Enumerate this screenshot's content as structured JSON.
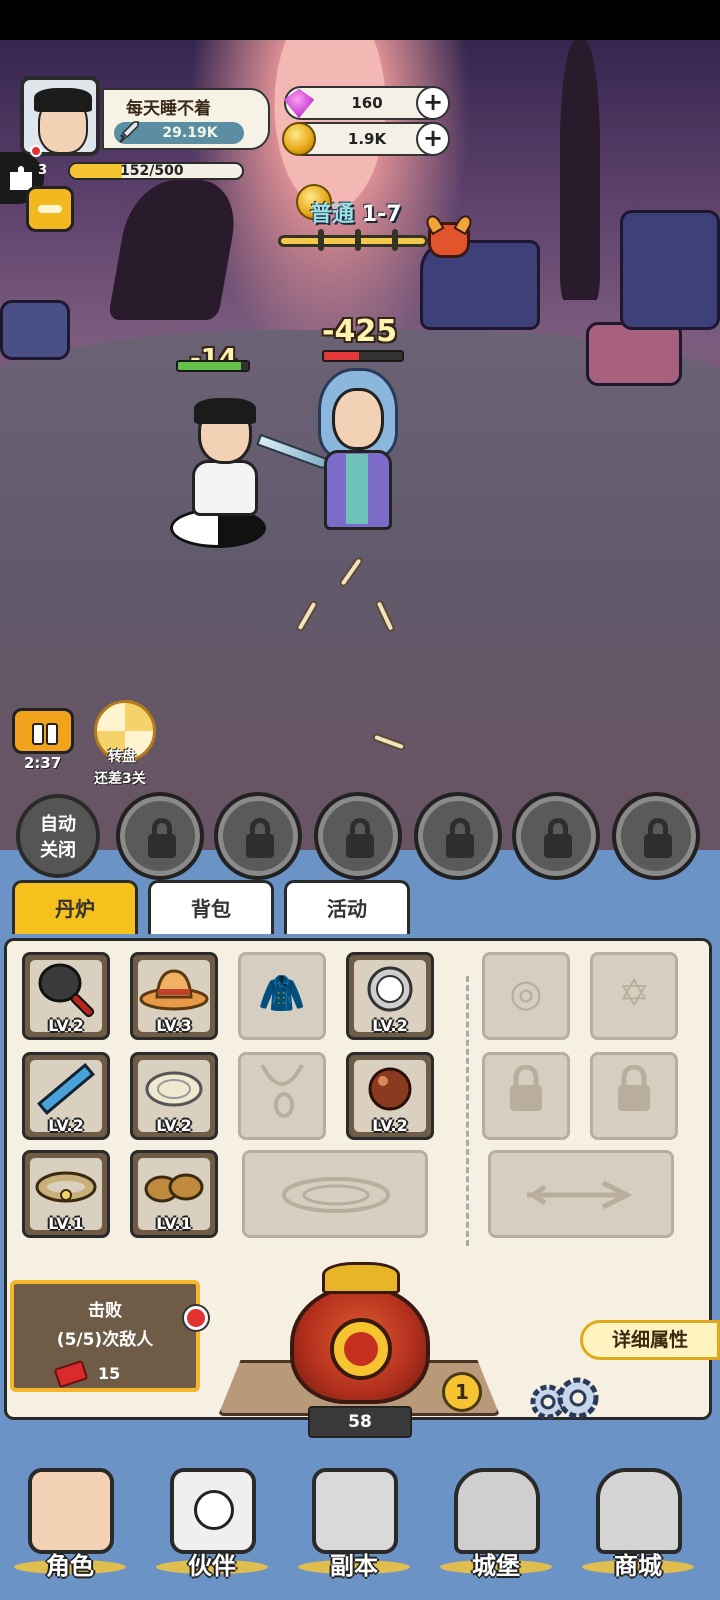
{
  "player": {
    "name": "每天睡不着",
    "power": "29.19K",
    "level": "3",
    "xp_text": "152/500",
    "xp_fraction": 0.304
  },
  "currencies": {
    "gems": "160",
    "coins": "1.9K"
  },
  "stage": {
    "mode": "普通",
    "number": "1-7",
    "progress_fraction": 0.8
  },
  "battle": {
    "enemy_damage": "-425",
    "hero_damage": "-14",
    "enemy_hp_fraction": 0.45,
    "hero_hp_fraction": 0.9,
    "timer": "2:37"
  },
  "wheel": {
    "title": "转盘",
    "subtitle": "还差3关"
  },
  "skills": {
    "auto_label_line1": "自动",
    "auto_label_line2": "关闭"
  },
  "tabs": [
    "丹炉",
    "背包",
    "活动"
  ],
  "equipment": [
    {
      "name": "frying-pan",
      "level": "LV.2"
    },
    {
      "name": "straw-hat",
      "level": "LV.3"
    },
    {
      "name": "armor",
      "level": ""
    },
    {
      "name": "orb-badge",
      "level": "LV.2"
    },
    {
      "name": "ruler",
      "level": "LV.2"
    },
    {
      "name": "plate",
      "level": "LV.2"
    },
    {
      "name": "necklace",
      "level": ""
    },
    {
      "name": "bead",
      "level": "LV.2"
    },
    {
      "name": "belt",
      "level": "LV.1"
    },
    {
      "name": "sandals",
      "level": "LV.1"
    }
  ],
  "quest": {
    "line1": "击败",
    "line2": "(5/5)次敌人",
    "reward": "15"
  },
  "furnace": {
    "count": "58",
    "badge": "1"
  },
  "detail_button": "详细属性",
  "nav": [
    "角色",
    "伙伴",
    "副本",
    "城堡",
    "商城"
  ],
  "colors": {
    "accent_yellow": "#f6c11c",
    "panel_bg": "#f5f0e2",
    "nav_blue": "#6c93c6"
  }
}
